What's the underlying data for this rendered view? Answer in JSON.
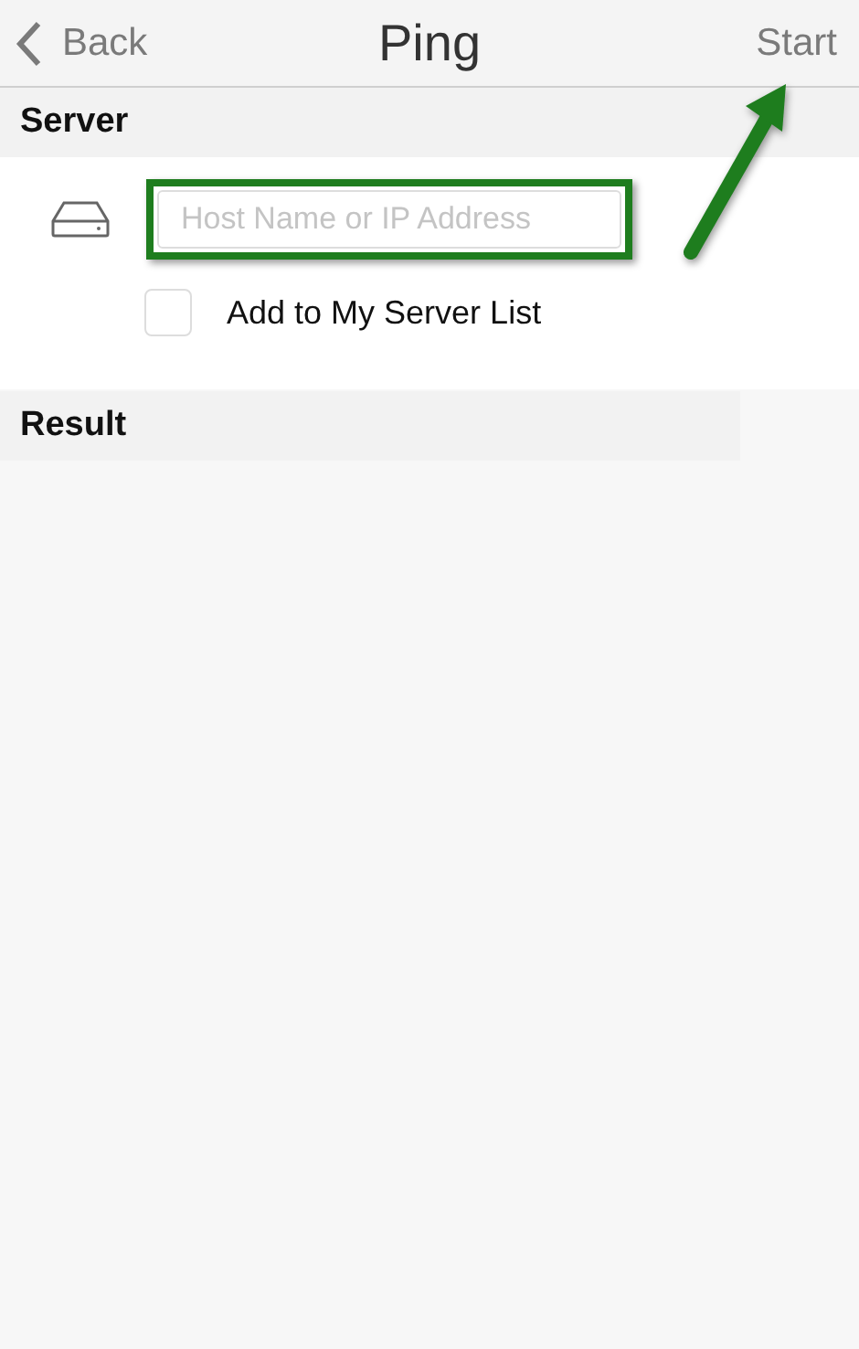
{
  "nav_bar": {
    "back": "Back",
    "title": "Ping",
    "action": "Start"
  },
  "server_section": {
    "header": "Server",
    "host_field": {
      "placeholder": "Host Name or IP Address"
    },
    "add_to_list": {
      "label": "Add to My Server List",
      "checked": false
    }
  },
  "result_section": {
    "header": "Result"
  }
}
